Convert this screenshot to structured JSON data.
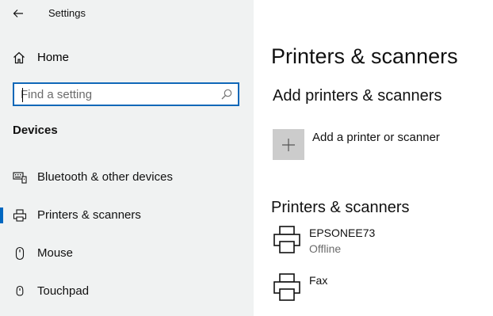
{
  "window": {
    "title": "Settings"
  },
  "sidebar": {
    "home_label": "Home",
    "search": {
      "value": "",
      "placeholder": "Find a setting"
    },
    "section_heading": "Devices",
    "items": [
      {
        "label": "Bluetooth & other devices",
        "icon": "bluetooth-devices-icon",
        "selected": false
      },
      {
        "label": "Printers & scanners",
        "icon": "printer-icon",
        "selected": true
      },
      {
        "label": "Mouse",
        "icon": "mouse-icon",
        "selected": false
      },
      {
        "label": "Touchpad",
        "icon": "touchpad-icon",
        "selected": false
      }
    ],
    "accent_color": "#0067c0"
  },
  "main": {
    "title": "Printers & scanners",
    "add_section": {
      "heading": "Add printers & scanners",
      "add_label": "Add a printer or scanner"
    },
    "list_section": {
      "heading": "Printers & scanners",
      "printers": [
        {
          "name": "EPSONEE73",
          "status": "Offline"
        },
        {
          "name": "Fax",
          "status": ""
        }
      ]
    }
  }
}
